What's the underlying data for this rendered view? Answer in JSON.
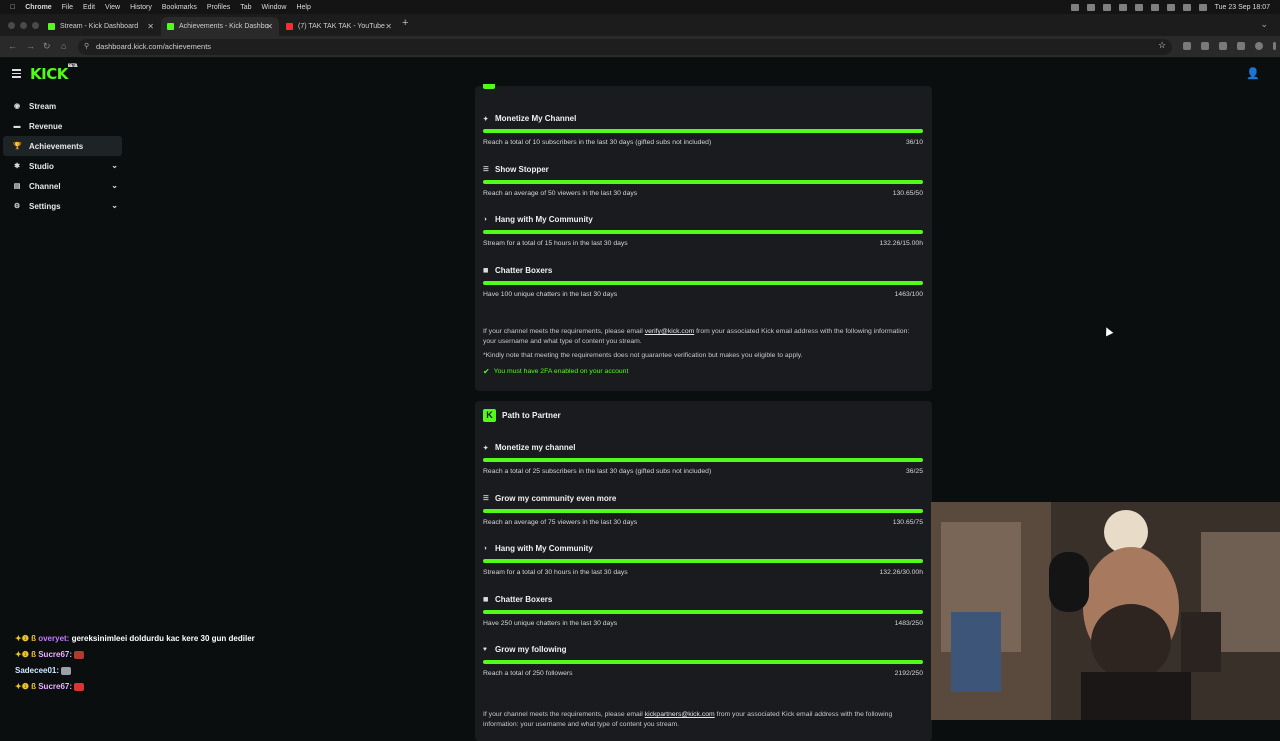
{
  "menubar": {
    "app": "Chrome",
    "items": [
      "File",
      "Edit",
      "View",
      "History",
      "Bookmarks",
      "Profiles",
      "Tab",
      "Window",
      "Help"
    ],
    "clock": "Tue 23 Sep  18:07"
  },
  "tabs": [
    {
      "title": "Stream - Kick Dashboard",
      "favicon": "kick-icon"
    },
    {
      "title": "Achievements - Kick Dashbo",
      "favicon": "kick-icon"
    },
    {
      "title": "(7) TAK TAK TAK - YouTube",
      "favicon": "youtube-icon"
    }
  ],
  "address": {
    "url": "dashboard.kick.com/achievements"
  },
  "logo": {
    "text": "KICK",
    "badge": "BETA"
  },
  "sidebar": {
    "items": [
      {
        "label": "Stream",
        "icon": "stream-icon",
        "expandable": false,
        "active": false
      },
      {
        "label": "Revenue",
        "icon": "revenue-icon",
        "expandable": false,
        "active": false
      },
      {
        "label": "Achievements",
        "icon": "trophy-icon",
        "expandable": false,
        "active": true
      },
      {
        "label": "Studio",
        "icon": "studio-icon",
        "expandable": true,
        "active": false
      },
      {
        "label": "Channel",
        "icon": "channel-icon",
        "expandable": true,
        "active": false
      },
      {
        "label": "Settings",
        "icon": "gear-icon",
        "expandable": true,
        "active": false
      }
    ]
  },
  "verified": {
    "achievements": [
      {
        "title": "Monetize My Channel",
        "desc": "Reach a total of 10 subscribers in the last 30 days (gifted subs not included)",
        "value": "36/10",
        "progress": 1.0
      },
      {
        "title": "Show Stopper",
        "desc": "Reach an average of 50 viewers in the last 30 days",
        "value": "130.65/50",
        "progress": 1.0
      },
      {
        "title": "Hang with My Community",
        "desc": "Stream for a total of 15 hours in the last 30 days",
        "value": "132.26/15.00h",
        "progress": 1.0
      },
      {
        "title": "Chatter Boxers",
        "desc": "Have 100 unique chatters in the last 30 days",
        "value": "1463/100",
        "progress": 1.0
      }
    ],
    "info_pre": "If your channel meets the requirements, please email ",
    "info_email": "verify@kick.com",
    "info_post": " from your associated Kick email address with the following information: your username and what type of content you stream.",
    "note": "*Kindly note that meeting the requirements does not guarantee verification but makes you eligible to apply.",
    "requirement": "You must have 2FA enabled on your account"
  },
  "partner": {
    "title": "Path to Partner",
    "achievements": [
      {
        "title": "Monetize my channel",
        "desc": "Reach a total of 25 subscribers in the last 30 days (gifted subs not included)",
        "value": "36/25",
        "progress": 1.0
      },
      {
        "title": "Grow my community even more",
        "desc": "Reach an average of 75 viewers in the last 30 days",
        "value": "130.65/75",
        "progress": 1.0
      },
      {
        "title": "Hang with My Community",
        "desc": "Stream for a total of 30 hours in the last 30 days",
        "value": "132.26/30.00h",
        "progress": 1.0
      },
      {
        "title": "Chatter Boxers",
        "desc": "Have 250 unique chatters in the last 30 days",
        "value": "1483/250",
        "progress": 1.0
      },
      {
        "title": "Grow my following",
        "desc": "Reach a total of 250 followers",
        "value": "2192/250",
        "progress": 1.0
      }
    ],
    "info_pre": "If your channel meets the requirements, please email ",
    "info_email": "kickpartners@kick.com",
    "info_post": " from your associated Kick email address with the following information: your username and what type of content you stream."
  },
  "chat": [
    {
      "user": "overyet:",
      "text": "gereksinimleei doldurdu kac kere 30 gun dediler",
      "color": "#c07dff"
    },
    {
      "user": "Sucre67:",
      "text": "",
      "color": "#e8b3ff"
    },
    {
      "user": "Sadecee01:",
      "text": "",
      "color": "#cfe7ff"
    },
    {
      "user": "Sucre67:",
      "text": "",
      "color": "#e8b3ff"
    }
  ],
  "colors": {
    "accent": "#53fc18",
    "background": "#0b0e0f",
    "card": "#191b1f"
  }
}
